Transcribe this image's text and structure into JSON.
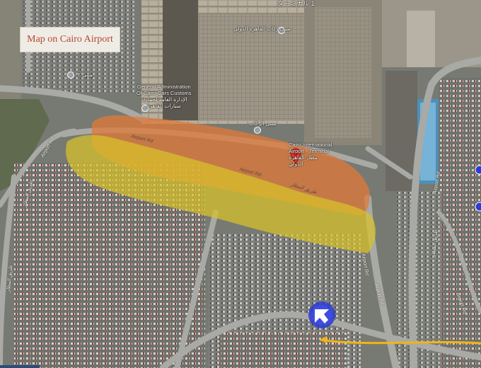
{
  "map": {
    "title": "Map on Cairo Airport",
    "labels": {
      "terminal_top": "ターミナル 1",
      "customs": "General Administration\nOf Cairo Cars Customs\nالإدارة العامة لجمارك\nسيارات القاهرة",
      "airport_name": "Cairo International\nAirport - Terminal\nمطار القاهرة\nالدولي",
      "arabic_top": "مبنى ركاب\nالقاهرة الدولي",
      "arabic_mid": "مبنى الركاب",
      "poi_left": "مبنى ٢"
    },
    "roads": {
      "airport_rd_1": "Airport Rd",
      "airport_rd_2": "Airport Rd",
      "arabic_road": "طريق المطار",
      "left_road_ar": "طريق المطار",
      "left_airport_rd": "Airport Rd",
      "right_airport_rd": "Airport Rd",
      "right_road_ar": "طريق المطار",
      "right_lower_rd": "Airport Rd",
      "far_left_ar": "طريق المطار",
      "east_rd": "Airport Rd",
      "bottom_rd": "Airport Rd"
    },
    "colors": {
      "orange_zone": "#e0793a",
      "yellow_zone": "#d8c22a",
      "route_line": "#f2b518",
      "pin": "#d9342b",
      "arrow_marker": "#2b3bd6"
    },
    "icons": [
      "location-pin-icon",
      "direction-arrow-icon",
      "poi-icon"
    ]
  }
}
